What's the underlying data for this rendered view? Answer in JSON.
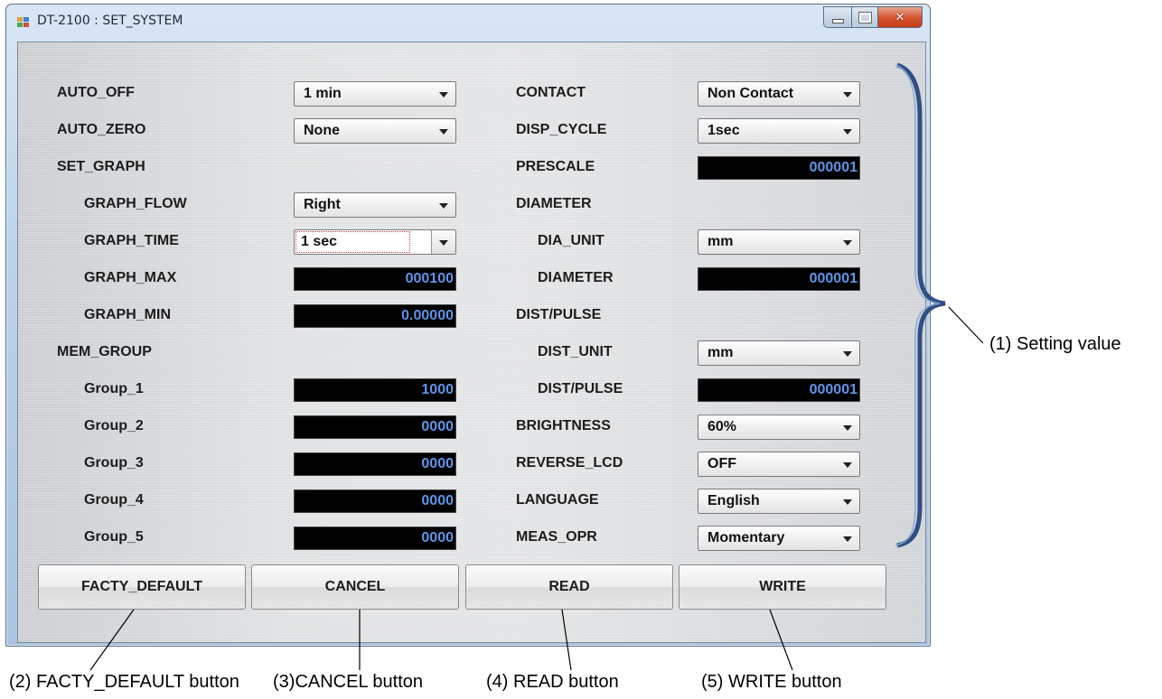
{
  "window": {
    "title": "DT-2100 : SET_SYSTEM"
  },
  "left": {
    "auto_off": {
      "label": "AUTO_OFF",
      "value": "1 min"
    },
    "auto_zero": {
      "label": "AUTO_ZERO",
      "value": "None"
    },
    "set_graph": {
      "label": "SET_GRAPH"
    },
    "graph_flow": {
      "label": "GRAPH_FLOW",
      "value": "Right"
    },
    "graph_time": {
      "label": "GRAPH_TIME",
      "value": "1 sec"
    },
    "graph_max": {
      "label": "GRAPH_MAX",
      "value": "000100"
    },
    "graph_min": {
      "label": "GRAPH_MIN",
      "value": "0.00000"
    },
    "mem_group": {
      "label": "MEM_GROUP"
    },
    "groups": [
      {
        "label": "Group_1",
        "value": "1000"
      },
      {
        "label": "Group_2",
        "value": "0000"
      },
      {
        "label": "Group_3",
        "value": "0000"
      },
      {
        "label": "Group_4",
        "value": "0000"
      },
      {
        "label": "Group_5",
        "value": "0000"
      }
    ]
  },
  "right": {
    "contact": {
      "label": "CONTACT",
      "value": "Non Contact"
    },
    "disp_cycle": {
      "label": "DISP_CYCLE",
      "value": "1sec"
    },
    "prescale": {
      "label": "PRESCALE",
      "value": "000001"
    },
    "diameter_group": {
      "label": "DIAMETER"
    },
    "dia_unit": {
      "label": "DIA_UNIT",
      "value": "mm"
    },
    "diameter": {
      "label": "DIAMETER",
      "value": "000001"
    },
    "dist_pulse_group": {
      "label": "DIST/PULSE"
    },
    "dist_unit": {
      "label": "DIST_UNIT",
      "value": "mm"
    },
    "dist_pulse": {
      "label": "DIST/PULSE",
      "value": "000001"
    },
    "brightness": {
      "label": "BRIGHTNESS",
      "value": "60%"
    },
    "reverse_lcd": {
      "label": "REVERSE_LCD",
      "value": "OFF"
    },
    "language": {
      "label": "LANGUAGE",
      "value": "English"
    },
    "meas_opr": {
      "label": "MEAS_OPR",
      "value": "Momentary"
    }
  },
  "buttons": {
    "facty_default": "FACTY_DEFAULT",
    "cancel": "CANCEL",
    "read": "READ",
    "write": "WRITE"
  },
  "annotations": {
    "setting_value": "(1) Setting value",
    "facty_default": "(2) FACTY_DEFAULT button",
    "cancel": "(3)CANCEL button",
    "read": "(4) READ button",
    "write": "(5) WRITE button"
  },
  "colors": {
    "numeric_text": "#5f95e8",
    "numeric_bg": "#000000",
    "bracket": "#2e4f86"
  }
}
